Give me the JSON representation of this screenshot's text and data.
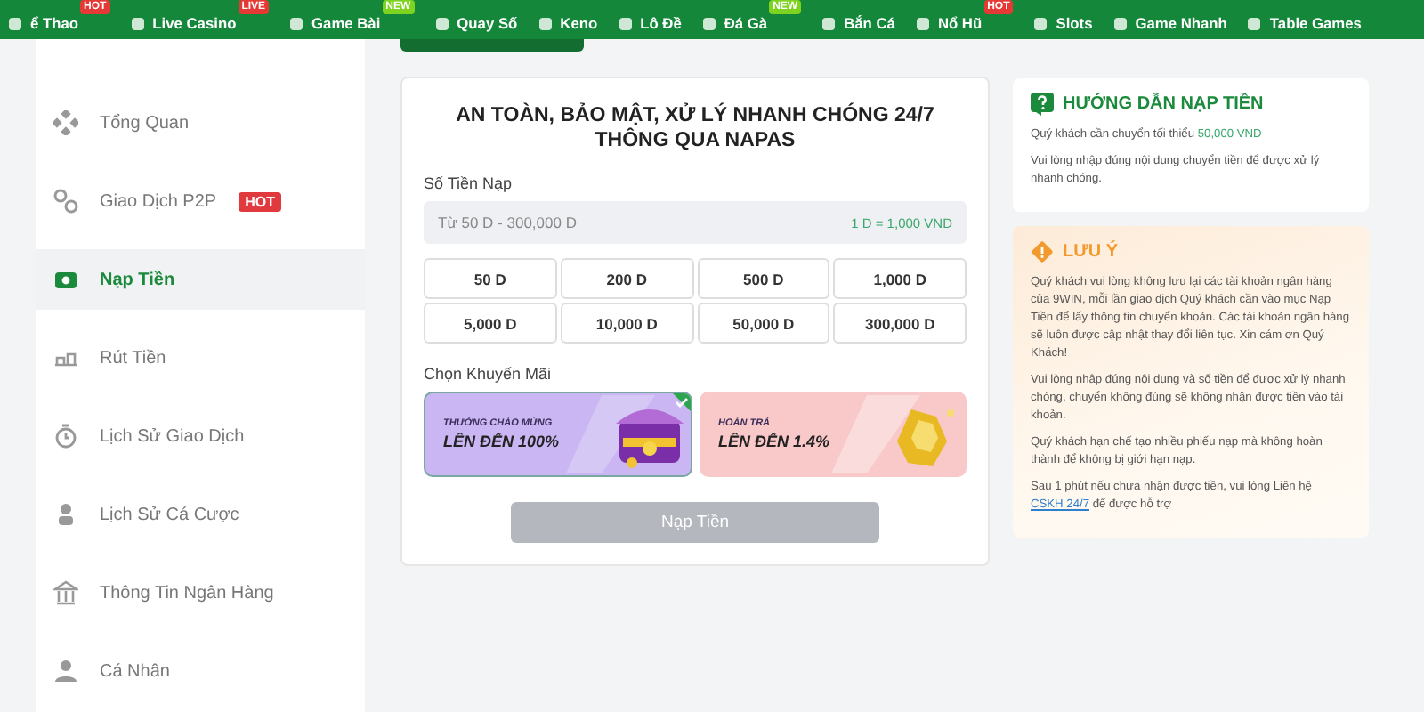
{
  "nav": [
    {
      "label": "ể Thao",
      "badge": {
        "text": "HOT",
        "color": "#e53935"
      }
    },
    {
      "label": "Live Casino",
      "badge": {
        "text": "LIVE",
        "color": "#e53935"
      }
    },
    {
      "label": "Game Bài",
      "badge": {
        "text": "NEW",
        "color": "#7ed321"
      }
    },
    {
      "label": "Quay Số"
    },
    {
      "label": "Keno"
    },
    {
      "label": "Lô Đề"
    },
    {
      "label": "Đá Gà",
      "badge": {
        "text": "NEW",
        "color": "#7ed321"
      }
    },
    {
      "label": "Bắn Cá"
    },
    {
      "label": "Nổ Hũ",
      "badge": {
        "text": "HOT",
        "color": "#e53935"
      }
    },
    {
      "label": "Slots"
    },
    {
      "label": "Game Nhanh"
    },
    {
      "label": "Table Games"
    }
  ],
  "sidebar": {
    "items": [
      {
        "label": "Tổng Quan",
        "selected": false
      },
      {
        "label": "Giao Dịch P2P",
        "selected": false,
        "badge": "HOT"
      },
      {
        "label": "Nạp Tiền",
        "selected": true
      },
      {
        "label": "Rút Tiền",
        "selected": false
      },
      {
        "label": "Lịch Sử Giao Dịch",
        "selected": false
      },
      {
        "label": "Lịch Sử Cá Cược",
        "selected": false
      },
      {
        "label": "Thông Tin Ngân Hàng",
        "selected": false
      },
      {
        "label": "Cá Nhân",
        "selected": false
      }
    ]
  },
  "deposit": {
    "title": "AN TOÀN, BẢO MẬT, XỬ LÝ NHANH CHÓNG 24/7\nTHÔNG QUA NAPAS",
    "amount_label": "Số Tiền Nạp",
    "amount_field": {
      "placeholder": "Từ 50 D - 300,000 D",
      "rate": "1 D = 1,000 VND"
    },
    "amounts": [
      {
        "label": "50 D",
        "selected": false
      },
      {
        "label": "200 D",
        "selected": false
      },
      {
        "label": "500 D",
        "selected": false
      },
      {
        "label": "1,000 D",
        "selected": false
      },
      {
        "label": "5,000 D",
        "selected": false
      },
      {
        "label": "10,000 D",
        "selected": false
      },
      {
        "label": "50,000 D",
        "selected": false
      },
      {
        "label": "300,000 D",
        "selected": false
      }
    ],
    "promo_label": "Chọn Khuyến Mãi",
    "promos": [
      {
        "kicker": "THƯỞNG CHÀO MỪNG",
        "headline": "LÊN ĐẾN 100%",
        "selected": true,
        "color": "#c9b6f2"
      },
      {
        "kicker": "HOÀN TRẢ",
        "headline": "LÊN ĐẾN 1.4%",
        "selected": false,
        "color": "#f9c9c9"
      }
    ],
    "submit": {
      "label": "Nạp Tiền",
      "disabled": true
    }
  },
  "guide": {
    "title": "HƯỚNG DẪN NẠP TIỀN",
    "paragraphs": [
      {
        "text": "Quý khách cần chuyển tối thiểu",
        "highlight": "50,000 VND"
      },
      {
        "text": "Vui lòng nhập đúng nội dung chuyển tiền để được xử lý nhanh chóng."
      }
    ]
  },
  "notice": {
    "title": "LƯU Ý",
    "paragraphs": [
      {
        "text": "Quý khách vui lòng không lưu lại các tài khoản ngân hàng của 9WIN, mỗi lần giao dịch Quý khách cần vào mục Nạp Tiền để lấy thông tin chuyển khoản. Các tài khoản ngân hàng sẽ luôn được cập nhật thay đổi liên tục. Xin cám ơn Quý Khách!"
      },
      {
        "text": "Vui lòng nhập đúng nội dung và số tiền để được xử lý nhanh chóng, chuyển không đúng sẽ không nhận được tiền vào tài khoản."
      },
      {
        "text": "Quý khách hạn chế tạo nhiều phiếu nạp mà không hoàn thành để không bị giới hạn nạp."
      },
      {
        "text": "Sau 1 phút nếu chưa nhận được tiền, vui lòng Liên hệ",
        "link": "CSKH 24/7",
        "after": "để được hỗ trợ"
      }
    ]
  }
}
